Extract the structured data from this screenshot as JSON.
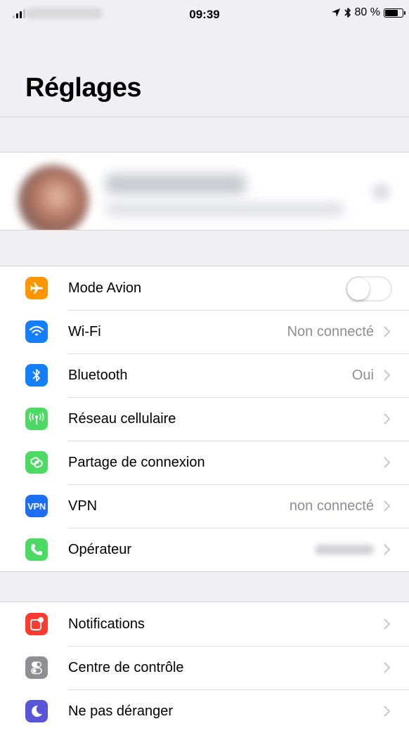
{
  "status_bar": {
    "time": "09:39",
    "battery_percent": "80 %",
    "battery_level": 0.8,
    "icons": [
      "signal-bars-icon",
      "location-arrow-icon",
      "bluetooth-icon",
      "battery-icon"
    ]
  },
  "header": {
    "title": "Réglages"
  },
  "profile": {
    "blurred": true
  },
  "groups": [
    {
      "rows": [
        {
          "label": "Mode Avion",
          "icon": "airplane-icon",
          "icon_color": "#ff9500",
          "control": "toggle",
          "toggle_on": false
        },
        {
          "label": "Wi-Fi",
          "icon": "wifi-icon",
          "icon_color": "#157efb",
          "value": "Non connecté"
        },
        {
          "label": "Bluetooth",
          "icon": "bluetooth-icon",
          "icon_color": "#157efb",
          "value": "Oui"
        },
        {
          "label": "Réseau cellulaire",
          "icon": "antenna-icon",
          "icon_color": "#4cd964"
        },
        {
          "label": "Partage de connexion",
          "icon": "link-icon",
          "icon_color": "#4cd964"
        },
        {
          "label": "VPN",
          "icon": "vpn-icon",
          "icon_label": "VPN",
          "icon_color": "#1c6ef3",
          "value": "non connecté"
        },
        {
          "label": "Opérateur",
          "icon": "phone-icon",
          "icon_color": "#4cd964",
          "value_blurred": true
        }
      ]
    },
    {
      "rows": [
        {
          "label": "Notifications",
          "icon": "notifications-icon",
          "icon_color": "#ff3b30"
        },
        {
          "label": "Centre de contrôle",
          "icon": "control-center-icon",
          "icon_color": "#8e8e93"
        },
        {
          "label": "Ne pas déranger",
          "icon": "moon-icon",
          "icon_color": "#5856d6"
        }
      ]
    }
  ]
}
